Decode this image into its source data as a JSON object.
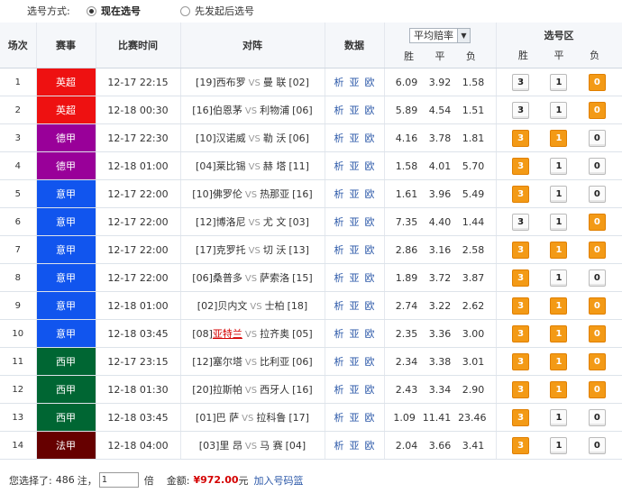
{
  "selection_mode": {
    "label": "选号方式:",
    "options": [
      "现在选号",
      "先发起后选号"
    ],
    "selected": "现在选号"
  },
  "table_header": {
    "index": "场次",
    "league": "赛事",
    "time": "比赛时间",
    "match": "对阵",
    "data": "数据",
    "odds_select": "平均赔率",
    "odds_sub": [
      "胜",
      "平",
      "负"
    ],
    "pick_area": "选号区",
    "pick_sub": [
      "胜",
      "平",
      "负"
    ]
  },
  "colors": {
    "英超": "#ee1111",
    "德甲": "#990099",
    "意甲": "#1155ee",
    "西甲": "#006633",
    "法甲": "#660000",
    "pick_on": "#f39a16"
  },
  "rows": [
    {
      "idx": "1",
      "league": "英超",
      "time": "12-17 22:15",
      "home_rank": "[19]",
      "home": "西布罗",
      "vs": "VS",
      "away": "曼 联",
      "away_rank": "[02]",
      "links": [
        "析",
        "亚",
        "欧"
      ],
      "odds": [
        "6.09",
        "3.92",
        "1.58"
      ],
      "picks": [
        false,
        false,
        true
      ]
    },
    {
      "idx": "2",
      "league": "英超",
      "time": "12-18 00:30",
      "home_rank": "[16]",
      "home": "伯恩茅",
      "vs": "VS",
      "away": "利物浦",
      "away_rank": "[06]",
      "links": [
        "析",
        "亚",
        "欧"
      ],
      "odds": [
        "5.89",
        "4.54",
        "1.51"
      ],
      "picks": [
        false,
        false,
        true
      ]
    },
    {
      "idx": "3",
      "league": "德甲",
      "time": "12-17 22:30",
      "home_rank": "[10]",
      "home": "汉诺威",
      "vs": "VS",
      "away": "勒 沃",
      "away_rank": "[06]",
      "links": [
        "析",
        "亚",
        "欧"
      ],
      "odds": [
        "4.16",
        "3.78",
        "1.81"
      ],
      "picks": [
        true,
        true,
        false
      ]
    },
    {
      "idx": "4",
      "league": "德甲",
      "time": "12-18 01:00",
      "home_rank": "[04]",
      "home": "莱比锡",
      "vs": "VS",
      "away": "赫 塔",
      "away_rank": "[11]",
      "links": [
        "析",
        "亚",
        "欧"
      ],
      "odds": [
        "1.58",
        "4.01",
        "5.70"
      ],
      "picks": [
        true,
        false,
        false
      ]
    },
    {
      "idx": "5",
      "league": "意甲",
      "time": "12-17 22:00",
      "home_rank": "[10]",
      "home": "佛罗伦",
      "vs": "VS",
      "away": "热那亚",
      "away_rank": "[16]",
      "links": [
        "析",
        "亚",
        "欧"
      ],
      "odds": [
        "1.61",
        "3.96",
        "5.49"
      ],
      "picks": [
        true,
        false,
        false
      ]
    },
    {
      "idx": "6",
      "league": "意甲",
      "time": "12-17 22:00",
      "home_rank": "[12]",
      "home": "博洛尼",
      "vs": "VS",
      "away": "尤 文",
      "away_rank": "[03]",
      "links": [
        "析",
        "亚",
        "欧"
      ],
      "odds": [
        "7.35",
        "4.40",
        "1.44"
      ],
      "picks": [
        false,
        false,
        true
      ]
    },
    {
      "idx": "7",
      "league": "意甲",
      "time": "12-17 22:00",
      "home_rank": "[17]",
      "home": "克罗托",
      "vs": "VS",
      "away": "切 沃",
      "away_rank": "[13]",
      "links": [
        "析",
        "亚",
        "欧"
      ],
      "odds": [
        "2.86",
        "3.16",
        "2.58"
      ],
      "picks": [
        true,
        true,
        true
      ]
    },
    {
      "idx": "8",
      "league": "意甲",
      "time": "12-17 22:00",
      "home_rank": "[06]",
      "home": "桑普多",
      "vs": "VS",
      "away": "萨索洛",
      "away_rank": "[15]",
      "links": [
        "析",
        "亚",
        "欧"
      ],
      "odds": [
        "1.89",
        "3.72",
        "3.87"
      ],
      "picks": [
        true,
        false,
        false
      ]
    },
    {
      "idx": "9",
      "league": "意甲",
      "time": "12-18 01:00",
      "home_rank": "[02]",
      "home": "贝内文",
      "vs": "VS",
      "away": "士柏",
      "away_rank": "[18]",
      "links": [
        "析",
        "亚",
        "欧"
      ],
      "odds": [
        "2.74",
        "3.22",
        "2.62"
      ],
      "picks": [
        true,
        true,
        true
      ]
    },
    {
      "idx": "10",
      "league": "意甲",
      "time": "12-18 03:45",
      "home_rank": "[08]",
      "home": "亚特兰",
      "home_red": true,
      "vs": "VS",
      "away": "拉齐奥",
      "away_rank": "[05]",
      "links": [
        "析",
        "亚",
        "欧"
      ],
      "odds": [
        "2.35",
        "3.36",
        "3.00"
      ],
      "picks": [
        true,
        true,
        true
      ]
    },
    {
      "idx": "11",
      "league": "西甲",
      "time": "12-17 23:15",
      "home_rank": "[12]",
      "home": "塞尔塔",
      "vs": "VS",
      "away": "比利亚",
      "away_rank": "[06]",
      "links": [
        "析",
        "亚",
        "欧"
      ],
      "odds": [
        "2.34",
        "3.38",
        "3.01"
      ],
      "picks": [
        true,
        true,
        true
      ]
    },
    {
      "idx": "12",
      "league": "西甲",
      "time": "12-18 01:30",
      "home_rank": "[20]",
      "home": "拉斯帕",
      "vs": "VS",
      "away": "西牙人",
      "away_rank": "[16]",
      "links": [
        "析",
        "亚",
        "欧"
      ],
      "odds": [
        "2.43",
        "3.34",
        "2.90"
      ],
      "picks": [
        true,
        true,
        true
      ]
    },
    {
      "idx": "13",
      "league": "西甲",
      "time": "12-18 03:45",
      "home_rank": "[01]",
      "home": "巴 萨",
      "vs": "VS",
      "away": "拉科鲁",
      "away_rank": "[17]",
      "links": [
        "析",
        "亚",
        "欧"
      ],
      "odds": [
        "1.09",
        "11.41",
        "23.46"
      ],
      "picks": [
        true,
        false,
        false
      ]
    },
    {
      "idx": "14",
      "league": "法甲",
      "time": "12-18 04:00",
      "home_rank": "[03]",
      "home": "里 昂",
      "vs": "VS",
      "away": "马 赛",
      "away_rank": "[04]",
      "links": [
        "析",
        "亚",
        "欧"
      ],
      "odds": [
        "2.04",
        "3.66",
        "3.41"
      ],
      "picks": [
        true,
        false,
        false
      ]
    }
  ],
  "pick_labels": [
    "3",
    "1",
    "0"
  ],
  "footer": {
    "selected_prefix": "您选择了:",
    "selected_count": "486",
    "selected_suffix": "注，",
    "multiplier": "1",
    "mult_unit": "倍",
    "amount_label": "金额:",
    "amount": "¥972.00",
    "amount_unit": "元",
    "basket": "加入号码篮"
  }
}
